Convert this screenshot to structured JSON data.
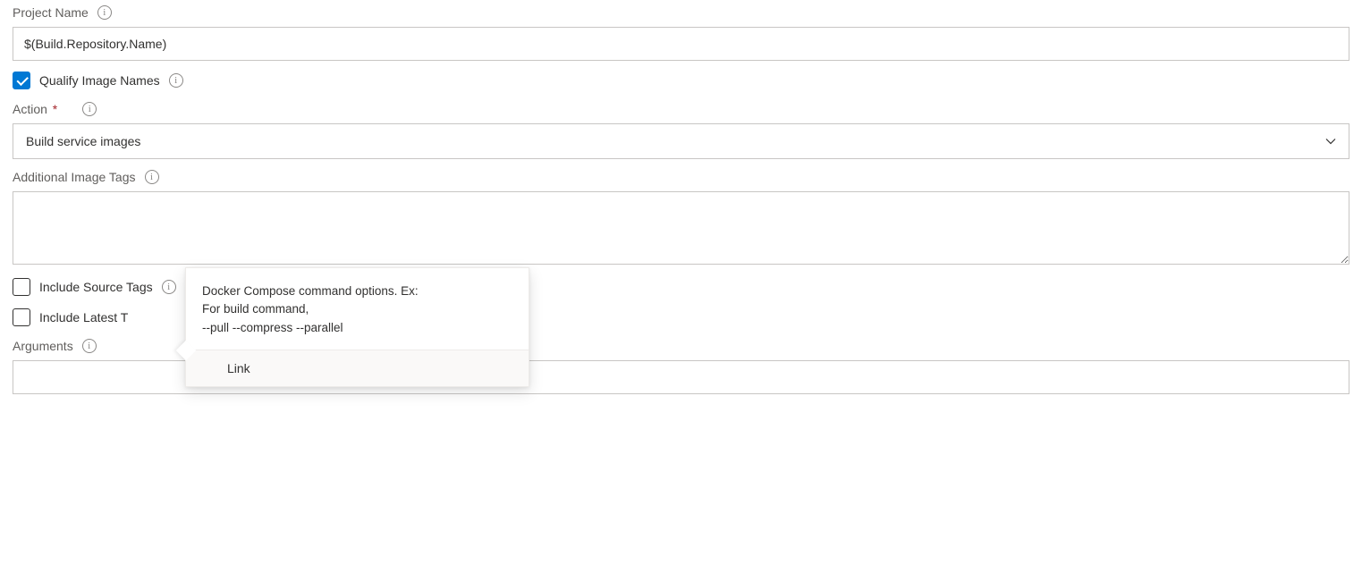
{
  "fields": {
    "project_name": {
      "label": "Project Name",
      "value": "$(Build.Repository.Name)"
    },
    "qualify_image_names": {
      "label": "Qualify Image Names",
      "checked": true
    },
    "action": {
      "label": "Action",
      "value": "Build service images"
    },
    "additional_image_tags": {
      "label": "Additional Image Tags",
      "value": ""
    },
    "include_source_tags": {
      "label": "Include Source Tags",
      "checked": false
    },
    "include_latest_tag": {
      "label": "Include Latest Tag",
      "label_truncated": "Include Latest T",
      "checked": false
    },
    "arguments": {
      "label": "Arguments",
      "value": ""
    }
  },
  "tooltip": {
    "line1": "Docker Compose command options. Ex:",
    "line2": "For build command,",
    "line3": "--pull --compress --parallel",
    "footer_link": "Link"
  }
}
